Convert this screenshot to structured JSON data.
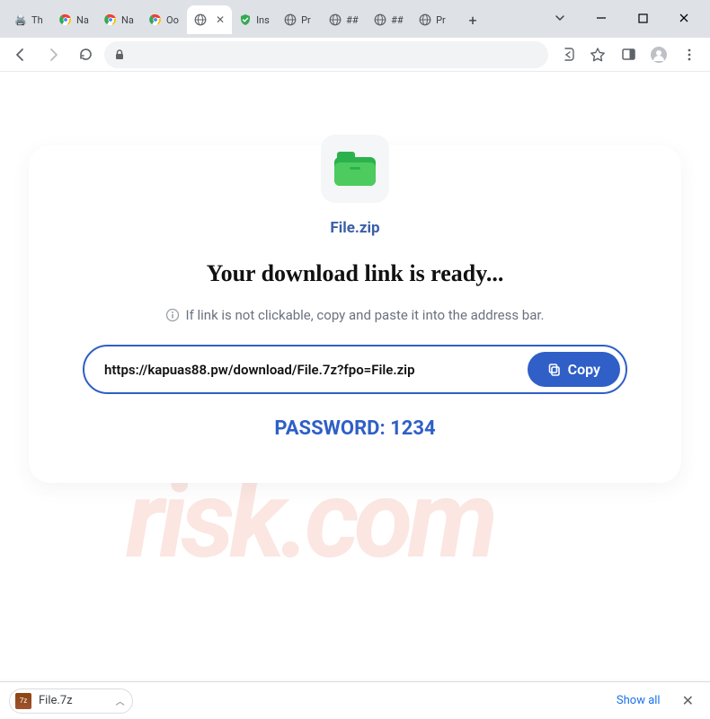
{
  "window": {
    "dropdown_icon": "chevron-down",
    "minimize": "—",
    "maximize": "□",
    "close": "✕"
  },
  "tabs": [
    {
      "label": "Th",
      "favicon": "printer"
    },
    {
      "label": "Na",
      "favicon": "chrome"
    },
    {
      "label": "Na",
      "favicon": "chrome"
    },
    {
      "label": "Oo",
      "favicon": "chrome"
    },
    {
      "label": "",
      "favicon": "globe",
      "active": true
    },
    {
      "label": "Ins",
      "favicon": "shield"
    },
    {
      "label": "Pr",
      "favicon": "globe"
    },
    {
      "label": "##",
      "favicon": "globe"
    },
    {
      "label": "##",
      "favicon": "globe"
    },
    {
      "label": "Pr",
      "favicon": "globe"
    }
  ],
  "newtab": "+",
  "toolbar": {
    "url_display": "",
    "secure": true
  },
  "page": {
    "filename": "File.zip",
    "headline": "Your download link is ready...",
    "hint": "If link is not clickable, copy and paste it into the address bar.",
    "link": "https://kapuas88.pw/download/File.7z?fpo=File.zip",
    "copy_label": "Copy",
    "password_label": "PASSWORD: 1234"
  },
  "downloads": {
    "item_name": "File.7z",
    "show_all": "Show all"
  }
}
